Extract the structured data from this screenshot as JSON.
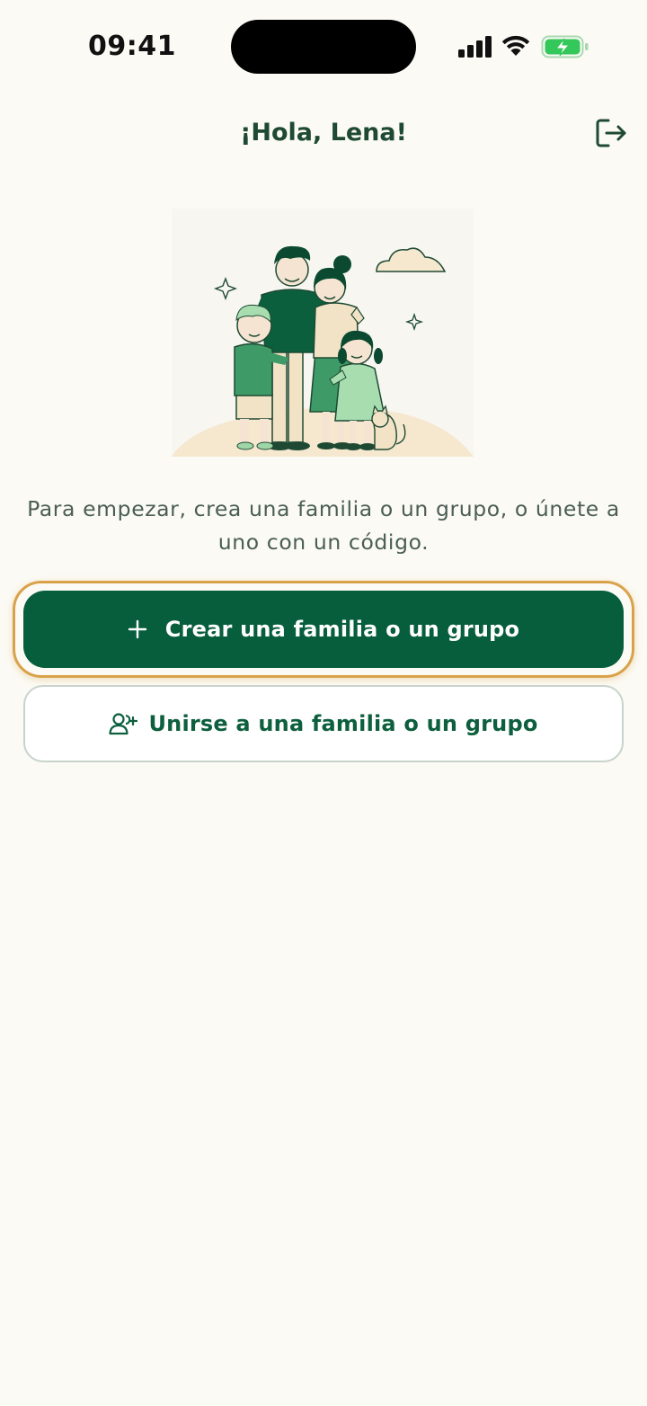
{
  "status_bar": {
    "time": "09:41",
    "icons": [
      "cellular-signal-icon",
      "wifi-icon",
      "battery-charging-icon"
    ]
  },
  "header": {
    "title": "¡Hola, Lena!",
    "logout_icon": "logout-icon"
  },
  "illustration": {
    "subject": "family-illustration"
  },
  "intro": {
    "text": "Para empezar, crea una familia o un grupo, o únete a uno con un código."
  },
  "actions": {
    "create_label": "Crear una familia o un grupo",
    "create_icon": "plus-icon",
    "join_label": "Unirse a una familia o un grupo",
    "join_icon": "user-add-icon"
  },
  "colors": {
    "background": "#FBFAF4",
    "primary": "#075E3D",
    "focus_ring": "#D9A24A",
    "text": "#1E4A33",
    "muted_text": "#4A5E54",
    "battery": "#34C759"
  }
}
